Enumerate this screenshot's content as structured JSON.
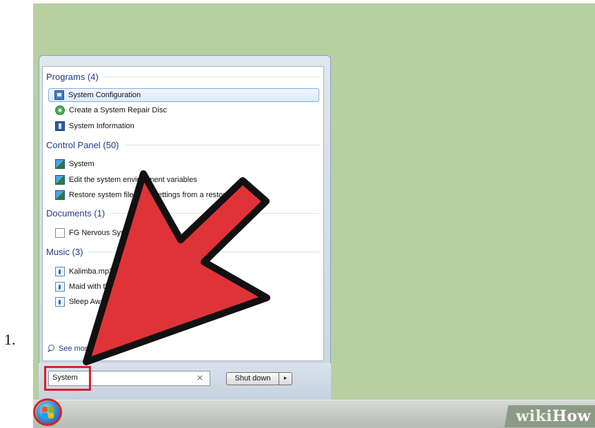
{
  "step_number": "1.",
  "results": {
    "groups": [
      {
        "label": "Programs (4)",
        "items": [
          {
            "label": "System Configuration",
            "icon": "monitor-icon",
            "selected": true
          },
          {
            "label": "Create a System Repair Disc",
            "icon": "disc-icon"
          },
          {
            "label": "System Information",
            "icon": "info-icon"
          }
        ]
      },
      {
        "label": "Control Panel (50)",
        "items": [
          {
            "label": "System",
            "icon": "control-panel-icon"
          },
          {
            "label": "Edit the system environment variables",
            "icon": "control-panel-icon"
          },
          {
            "label": "Restore system files and settings from a restore point",
            "icon": "control-panel-icon"
          }
        ]
      },
      {
        "label": "Documents (1)",
        "items": [
          {
            "label": "FG Nervous System",
            "icon": "document-icon"
          }
        ]
      },
      {
        "label": "Music (3)",
        "items": [
          {
            "label": "Kalimba.mp3",
            "icon": "music-file-icon"
          },
          {
            "label": "Maid with the Flaxen Hair.mp3",
            "icon": "music-file-icon"
          },
          {
            "label": "Sleep Away.mp3",
            "icon": "music-file-icon"
          }
        ]
      }
    ],
    "see_more": "See more results"
  },
  "search": {
    "value": "System",
    "clear_icon": "close-icon"
  },
  "shutdown": {
    "label": "Shut down",
    "arrow": "▸"
  },
  "watermark": {
    "wiki": "wiki",
    "how": "How"
  },
  "colors": {
    "desktop": "#b8cfa2",
    "highlight_red": "#d6202b",
    "arrow_red": "#e03338",
    "group_header": "#1e3a8a"
  }
}
